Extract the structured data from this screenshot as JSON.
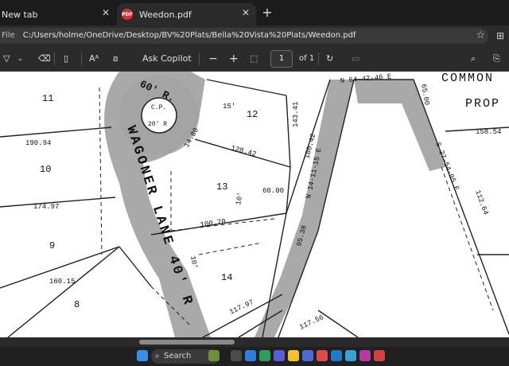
{
  "browser": {
    "tabs": [
      {
        "label": "New tab"
      },
      {
        "label": "Weedon.pdf",
        "icon": "pdf-icon"
      }
    ],
    "address": {
      "prefix": "File",
      "url": "C:/Users/holme/OneDrive/Desktop/BV%20Plats/Bella%20Vista%20Plats/Weedon.pdf"
    }
  },
  "pdf_toolbar": {
    "ask_copilot": "Ask Copilot",
    "page_value": "1",
    "page_total": "of 1",
    "zoom_out": "−",
    "zoom_in": "+"
  },
  "plat": {
    "street_name": "WAGONER LANE 40' R",
    "cul_de_sac_radius": "60' R.",
    "center_point": "C.P.",
    "center_radius": "20' R",
    "common_label": "COMMON",
    "prop_label": "PROP",
    "lots": [
      "11",
      "10",
      "9",
      "8",
      "12",
      "13",
      "14"
    ],
    "dimensions": [
      "190.94",
      "174.97",
      "160.15",
      "128.42",
      "60.00",
      "100.70",
      "117.97",
      "143.41",
      "180.42",
      "95.38",
      "117.56",
      "158.54",
      "112.64",
      "14.80",
      "10'",
      "15'",
      "10'",
      "65.00",
      "N 64-42-46 E",
      "N 14-11-15 E",
      "S 27-54-05 E"
    ]
  },
  "taskbar": {
    "search_label": "Search"
  },
  "colors": {
    "pdf_badge": "#d13438",
    "road_shade": "#9a9a9a"
  }
}
